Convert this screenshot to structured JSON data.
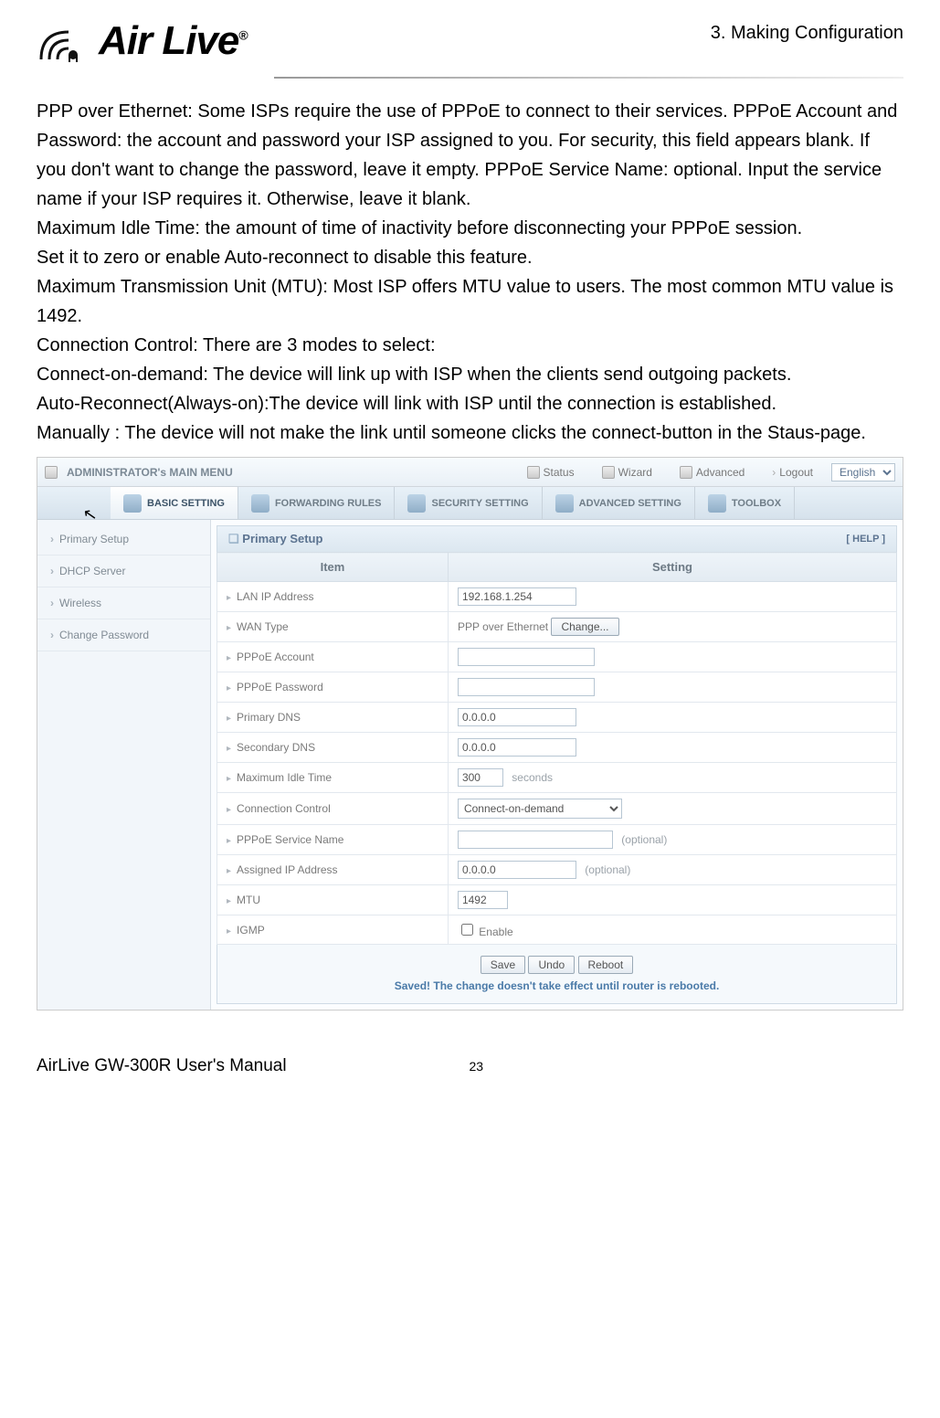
{
  "header": {
    "chapter": "3. Making Configuration",
    "logo_text": "Air Live",
    "logo_reg": "®"
  },
  "bodytext": {
    "p1": "PPP over Ethernet: Some ISPs require the use of   PPPoE to connect to their services. PPPoE Account and Password: the account and password your ISP assigned to you. For security, this field appears blank. If you don't want to change the password, leave it empty. PPPoE Service Name: optional. Input the service name if your ISP requires it. Otherwise, leave it blank.",
    "p2": "Maximum Idle Time: the amount of time of inactivity before disconnecting your PPPoE session.",
    "p3": "Set it to zero or enable Auto-reconnect to disable this feature.",
    "p4": "Maximum Transmission Unit (MTU): Most ISP offers MTU value to users. The most common MTU value is 1492.",
    "p5": "Connection Control: There are 3 modes to select:",
    "p6": "Connect-on-demand: The device will link up with ISP when the clients send outgoing packets.",
    "p7": "Auto-Reconnect(Always-on):The device will link with ISP until the connection is established.",
    "p8": "Manually : The device will not make the link until someone clicks the connect-button in the Staus-page."
  },
  "topbar": {
    "title": "ADMINISTRATOR's MAIN MENU",
    "status": "Status",
    "wizard": "Wizard",
    "advanced": "Advanced",
    "logout": "Logout",
    "language": "English"
  },
  "tabs": {
    "basic": "BASIC SETTING",
    "forwarding": "FORWARDING RULES",
    "security": "SECURITY SETTING",
    "advanced": "ADVANCED SETTING",
    "toolbox": "TOOLBOX"
  },
  "sidebar": {
    "items": [
      "Primary Setup",
      "DHCP Server",
      "Wireless",
      "Change Password"
    ]
  },
  "panel": {
    "title": "Primary Setup",
    "help": "[ HELP ]",
    "col_item": "Item",
    "col_setting": "Setting",
    "rows": {
      "lan_ip": {
        "label": "LAN IP Address",
        "value": "192.168.1.254"
      },
      "wan_type": {
        "label": "WAN Type",
        "value": "PPP over Ethernet",
        "button": "Change..."
      },
      "pppoe_account": {
        "label": "PPPoE Account",
        "value": ""
      },
      "pppoe_password": {
        "label": "PPPoE Password",
        "value": ""
      },
      "primary_dns": {
        "label": "Primary DNS",
        "value": "0.0.0.0"
      },
      "secondary_dns": {
        "label": "Secondary DNS",
        "value": "0.0.0.0"
      },
      "max_idle": {
        "label": "Maximum Idle Time",
        "value": "300",
        "unit": "seconds"
      },
      "conn_ctrl": {
        "label": "Connection Control",
        "value": "Connect-on-demand"
      },
      "service_name": {
        "label": "PPPoE Service Name",
        "value": "",
        "optional": "(optional)"
      },
      "assigned_ip": {
        "label": "Assigned IP Address",
        "value": "0.0.0.0",
        "optional": "(optional)"
      },
      "mtu": {
        "label": "MTU",
        "value": "1492"
      },
      "igmp": {
        "label": "IGMP",
        "checked": false,
        "checkbox_label": "Enable"
      }
    },
    "actions": {
      "save": "Save",
      "undo": "Undo",
      "reboot": "Reboot"
    },
    "saved_msg": "Saved! The change doesn't take effect until router is rebooted."
  },
  "footer": {
    "manual": "AirLive GW-300R User's Manual",
    "page": "23"
  }
}
